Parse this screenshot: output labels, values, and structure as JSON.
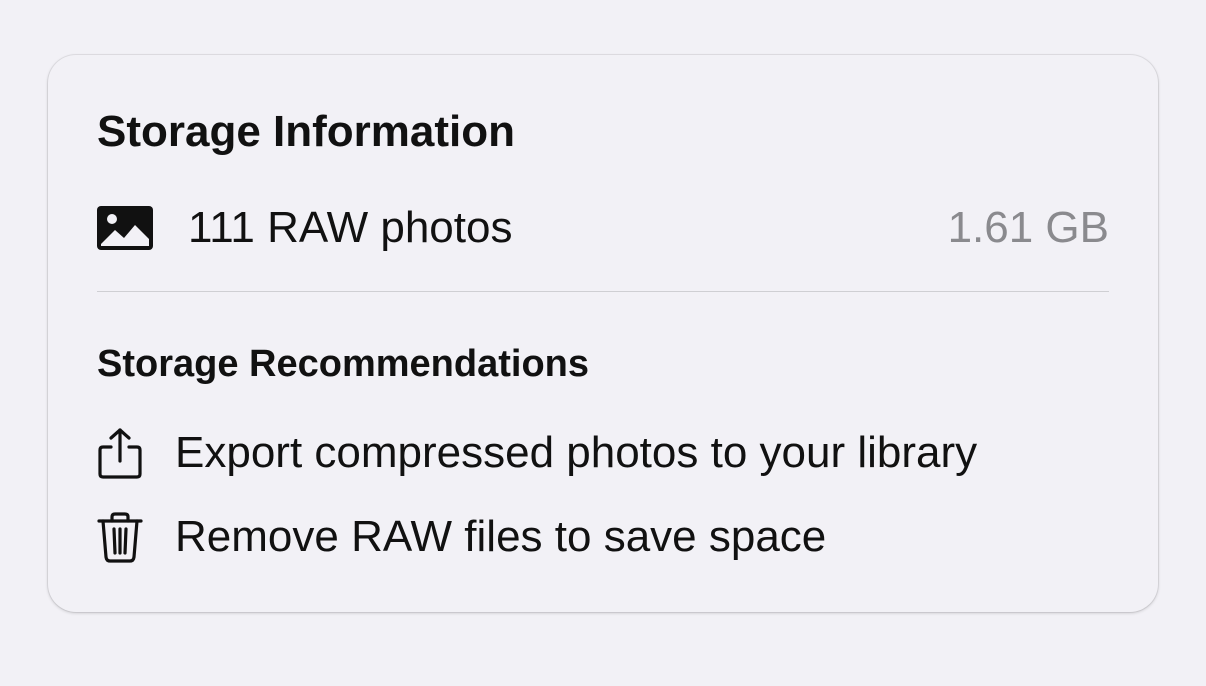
{
  "storage_info": {
    "title": "Storage Information",
    "items": [
      {
        "icon": "photo-icon",
        "label": "111 RAW photos",
        "value": "1.61 GB"
      }
    ]
  },
  "storage_recommendations": {
    "title": "Storage Recommendations",
    "items": [
      {
        "icon": "share-export-icon",
        "label": "Export compressed photos to your library"
      },
      {
        "icon": "trash-icon",
        "label": "Remove RAW files to save space"
      }
    ]
  },
  "colors": {
    "background": "#f2f1f6",
    "text_primary": "#111111",
    "text_secondary": "#8a8a8e",
    "divider": "#cfcfd3"
  }
}
